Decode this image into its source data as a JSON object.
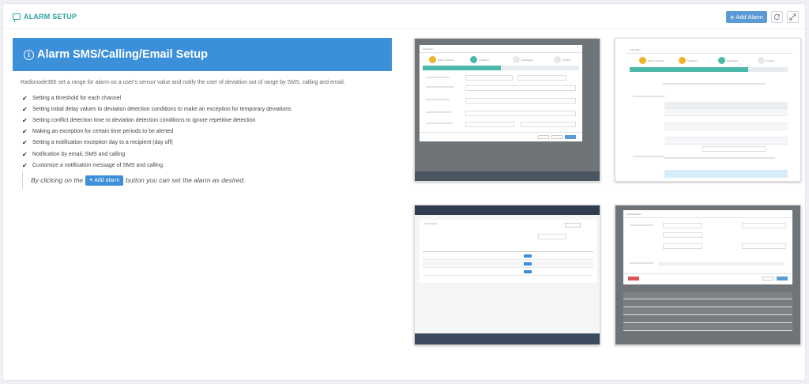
{
  "header": {
    "title": "ALARM SETUP",
    "add_alarm_label": "Add Alarm",
    "plus_icon": "+",
    "icons": [
      "chat-icon",
      "refresh-icon",
      "expand-icon"
    ]
  },
  "banner": {
    "title": "Alarm SMS/Calling/Email Setup",
    "info_glyph": "i"
  },
  "description": "Radionode365 set a range for alarm on a user's sensor value and notify the user of deviation out of range by SMS, calling and email.",
  "features": [
    "Setting a threshold for each channel",
    "Setting initial delay values to deviation detection conditions to make an exception for temporary deviations",
    "Setting conflict detection time to deviation detection conditions to ignore repetitive detection",
    "Making an exception for certain time periods to be alerted",
    "Setting a notification exception day to a recipient (day off)",
    "Notification by email, SMS and calling",
    "Customize a notification message of SMS and calling"
  ],
  "hint": {
    "before": "By clicking on the",
    "button": "Add alarm",
    "after": "button you can set the alarm as desired."
  },
  "colors": {
    "accent_teal": "#2aa3a0",
    "banner_blue": "#3c8fd9",
    "button_blue": "#5b9bd5"
  },
  "screenshots": [
    {
      "name": "add-alarm-condition-screenshot",
      "title": "Add Alarm",
      "steps": [
        "Select Channel",
        "Condition",
        "Notification",
        "Confirm"
      ]
    },
    {
      "name": "add-alarm-notification-screenshot",
      "title": "Add Alarm",
      "steps": [
        "Select Channel",
        "Condition",
        "Notification",
        "Confirm"
      ]
    },
    {
      "name": "alarm-list-screenshot",
      "title": "Alarm Setup"
    },
    {
      "name": "add-recipient-screenshot",
      "title": "Add Recipient"
    }
  ]
}
